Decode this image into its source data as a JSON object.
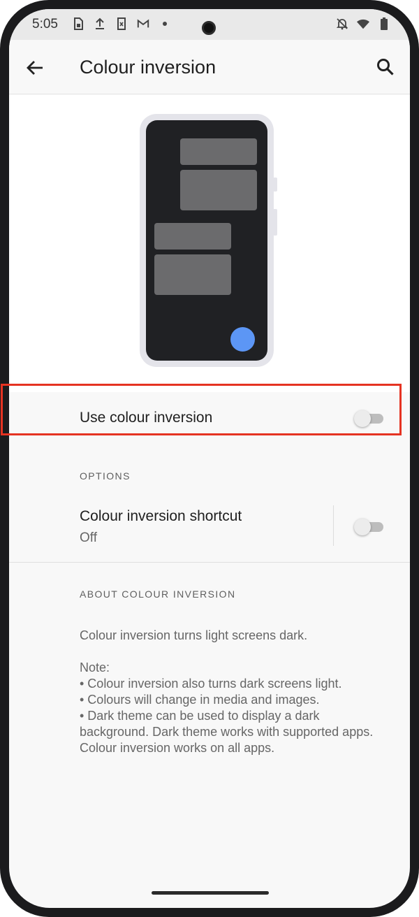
{
  "status_bar": {
    "time": "5:05",
    "left_icons": [
      "sim-icon",
      "upload-icon",
      "sd-card-icon",
      "gmail-icon",
      "dot-icon"
    ],
    "right_icons": [
      "notifications-off-icon",
      "wifi-icon",
      "battery-icon"
    ]
  },
  "app_bar": {
    "title": "Colour inversion",
    "back_icon": "back-arrow-icon",
    "search_icon": "search-icon"
  },
  "main_toggle": {
    "label": "Use colour inversion",
    "checked": false,
    "highlight_color": "#e53322"
  },
  "options_section": {
    "header": "OPTIONS",
    "shortcut": {
      "title": "Colour inversion shortcut",
      "summary": "Off",
      "checked": false
    }
  },
  "about_section": {
    "header": "ABOUT COLOUR INVERSION",
    "intro": "Colour inversion turns light screens dark.",
    "note_label": "Note:",
    "bullets": [
      "• Colour inversion also turns dark screens light.",
      "• Colours will change in media and images.",
      "• Dark theme can be used to display a dark background. Dark theme works with supported apps. Colour inversion works on all apps."
    ]
  },
  "colors": {
    "accent_fab": "#5c96f5",
    "screen_bg": "#f8f8f8",
    "preview_dark": "#202124"
  }
}
